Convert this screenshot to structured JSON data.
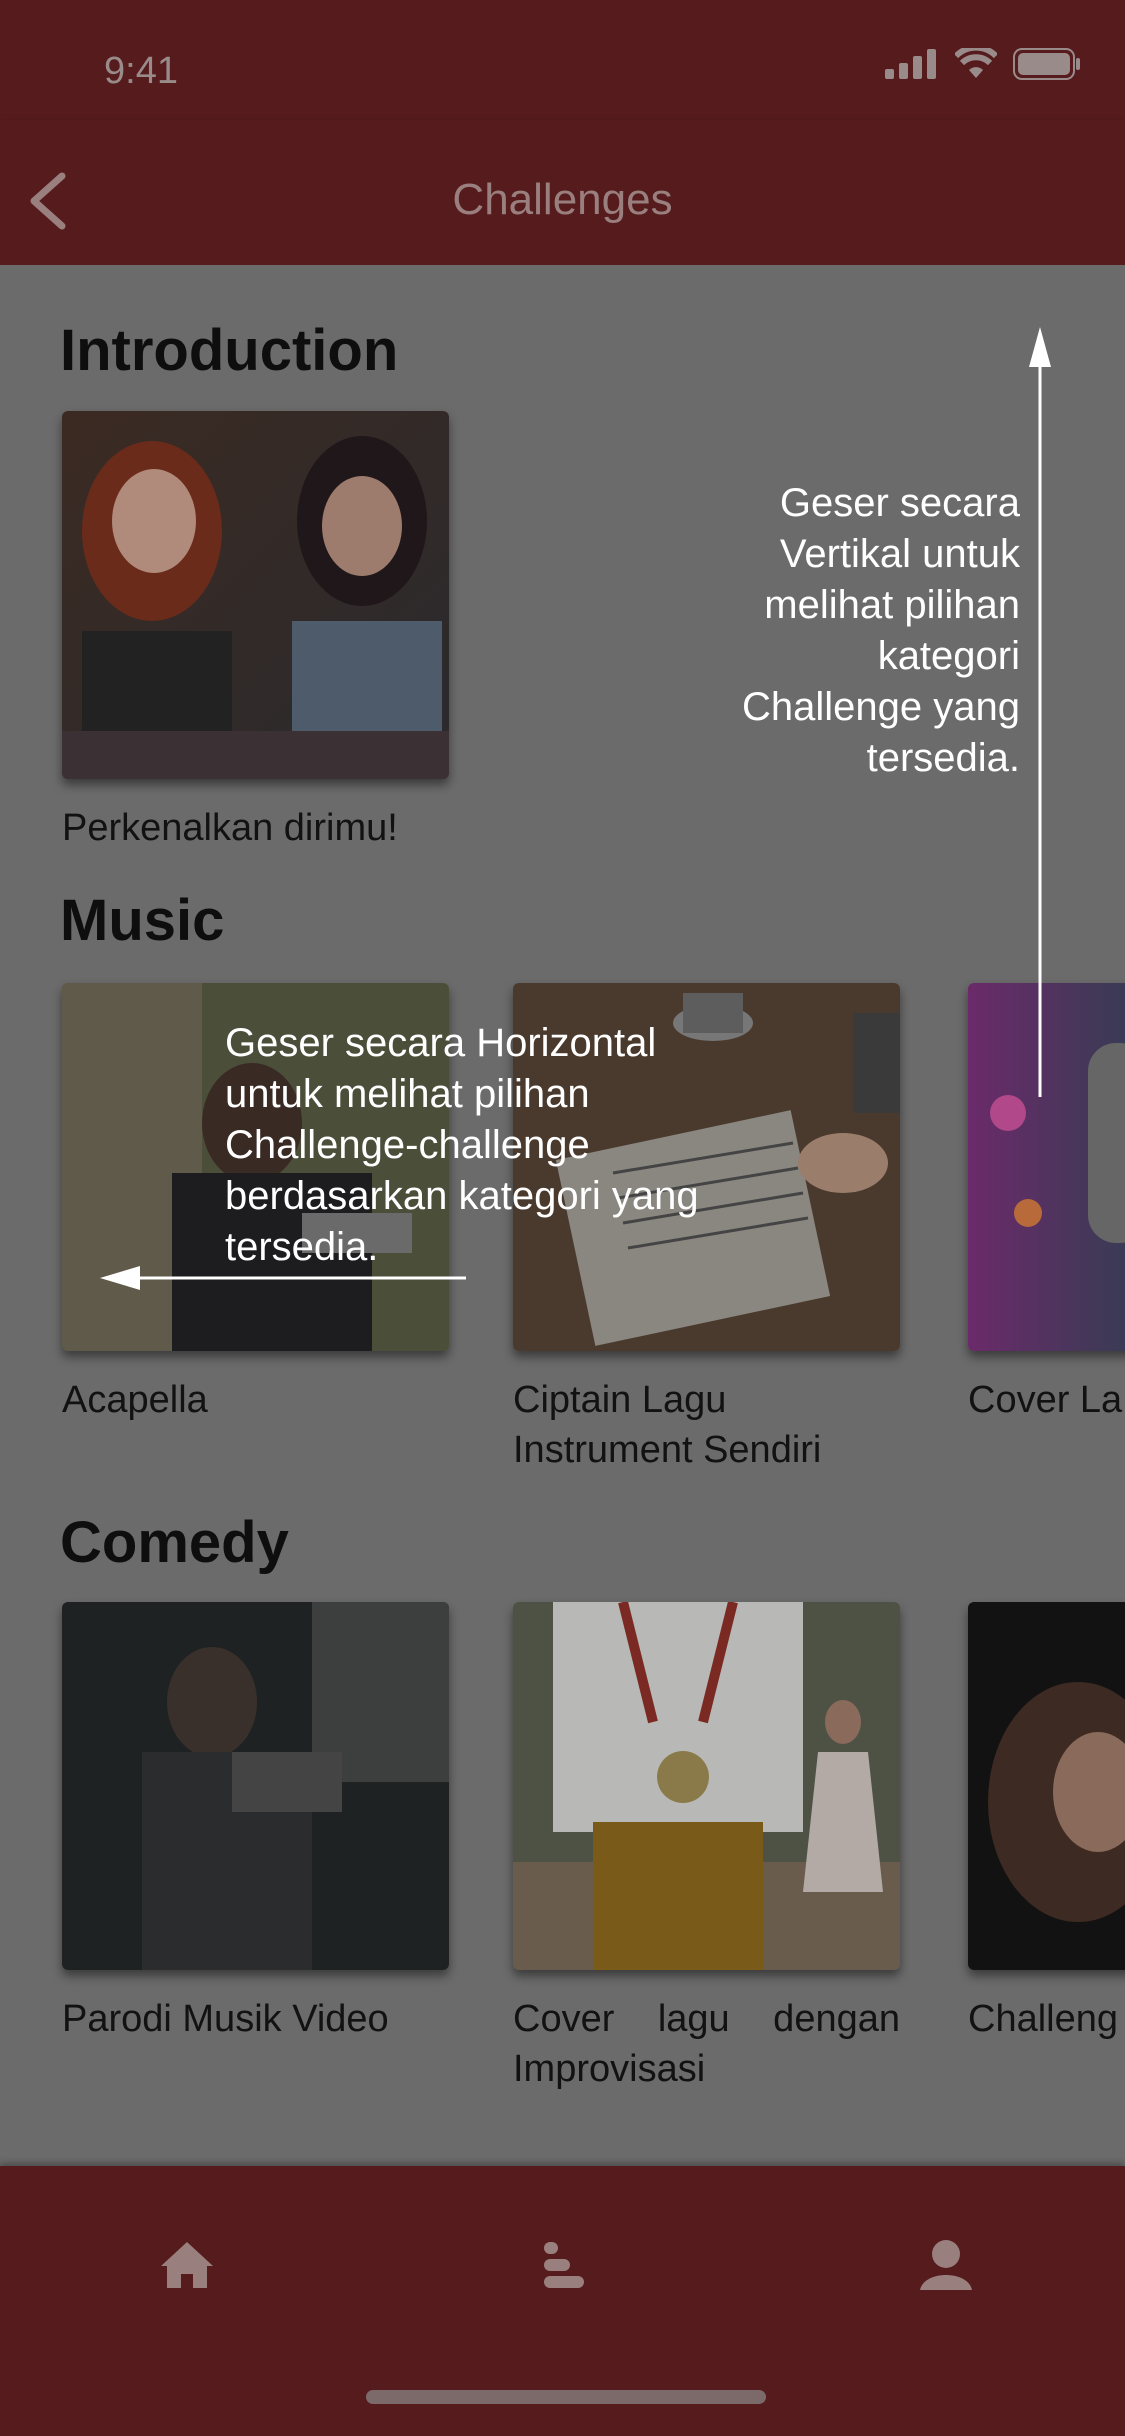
{
  "status_bar": {
    "time": "9:41"
  },
  "nav": {
    "title": "Challenges",
    "back_icon": "chevron-left-icon"
  },
  "sections": [
    {
      "title": "Introduction",
      "items": [
        {
          "label": "Perkenalkan dirimu!"
        }
      ]
    },
    {
      "title": "Music",
      "items": [
        {
          "label": "Acapella"
        },
        {
          "label": "Ciptain Lagu Instrument Sendiri"
        },
        {
          "label": "Cover La"
        }
      ]
    },
    {
      "title": "Comedy",
      "items": [
        {
          "label": "Parodi Musik Video"
        },
        {
          "label": "Cover lagu dengan Improvisasi"
        },
        {
          "label": "Challeng"
        }
      ]
    }
  ],
  "hints": {
    "vertical": "Geser secara Vertikal untuk melihat pilihan kategori Challenge yang tersedia.",
    "horizontal": "Geser secara Horizontal untuk melihat pilihan Challenge-challenge berdasarkan kategori yang tersedia."
  },
  "tabbar": {
    "items": [
      {
        "icon": "home-icon"
      },
      {
        "icon": "list-icon"
      },
      {
        "icon": "profile-icon"
      }
    ]
  },
  "colors": {
    "bar": "#561b1d",
    "overlay_bg": "#6b6b6b",
    "text": "#0e0e0e",
    "hint": "#ffffff"
  }
}
